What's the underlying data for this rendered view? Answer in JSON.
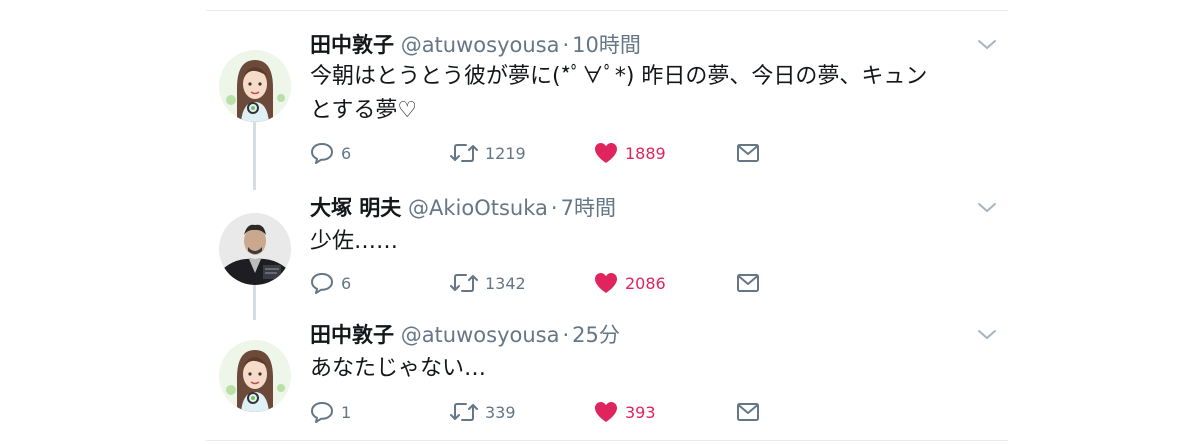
{
  "tweets": [
    {
      "name": "田中敦子",
      "handle": "@atuwosyousa",
      "separator": "·",
      "time": "10時間",
      "text_line1": "今朝はとうとう彼が夢に(*ﾟ∀ﾟ*) 昨日の夢、今日の夢、キュン",
      "text_line2": "とする夢♡",
      "replies": "6",
      "retweets": "1219",
      "likes": "1889",
      "liked": true
    },
    {
      "name": "大塚 明夫",
      "handle": "@AkioOtsuka",
      "separator": "·",
      "time": "7時間",
      "text_line1": "少佐……",
      "replies": "6",
      "retweets": "1342",
      "likes": "2086",
      "liked": true
    },
    {
      "name": "田中敦子",
      "handle": "@atuwosyousa",
      "separator": "·",
      "time": "25分",
      "text_line1": "あなたじゃない…",
      "replies": "1",
      "retweets": "339",
      "likes": "393",
      "liked": true
    }
  ],
  "colors": {
    "like_active": "#e0245e",
    "muted": "#657786",
    "divider": "#e6ecf0",
    "thread_line": "#d5dde3"
  },
  "icons": [
    "reply-icon",
    "retweet-icon",
    "heart-icon",
    "mail-icon",
    "chevron-down-icon"
  ]
}
